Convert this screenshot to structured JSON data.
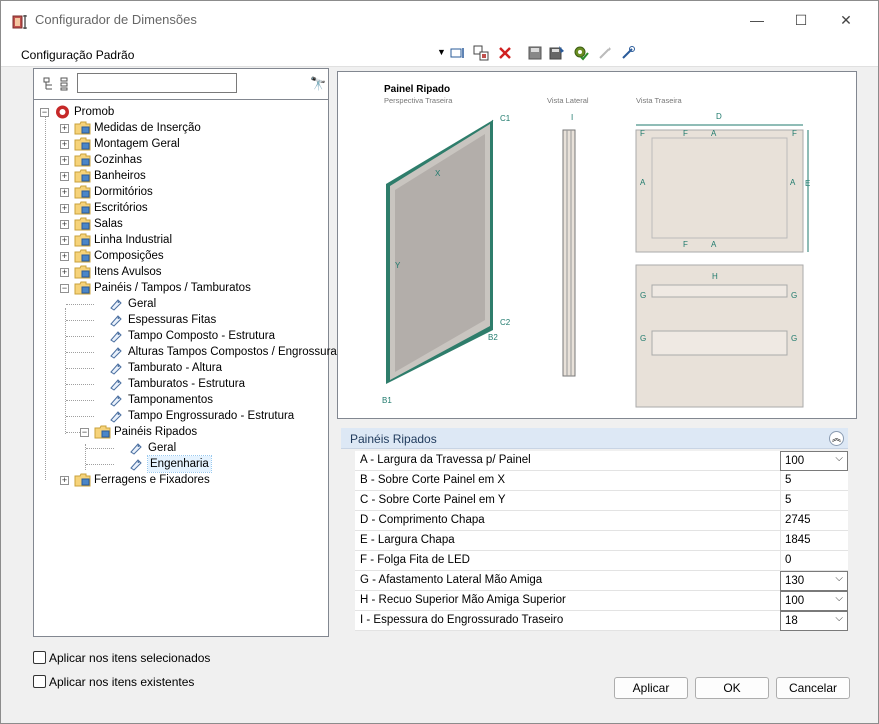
{
  "window": {
    "title": "Configurador de Dimensões",
    "min": "—",
    "max": "☐",
    "close": "✕"
  },
  "toolbar": {
    "config_name": "Configuração Padrão",
    "dropdown_arrow": "▼"
  },
  "left": {
    "search_value": "",
    "search_icon": "binoculars-icon"
  },
  "tree": {
    "root": "Promob",
    "items": [
      "Medidas de Inserção",
      "Montagem Geral",
      "Cozinhas",
      "Banheiros",
      "Dormitórios",
      "Escritórios",
      "Salas",
      "Linha Industrial",
      "Composições",
      "Itens Avulsos",
      "Painéis / Tampos / Tamburatos"
    ],
    "sub": [
      "Geral",
      "Espessuras Fitas",
      "Tampo Composto - Estrutura",
      "Alturas Tampos Compostos / Engrossurado",
      "Tamburato - Altura",
      "Tamburatos - Estrutura",
      "Tamponamentos",
      "Tampo Engrossurado - Estrutura",
      "Painéis Ripados"
    ],
    "subsub": [
      "Geral",
      "Engenharia"
    ],
    "last": "Ferragens e Fixadores"
  },
  "checks": {
    "selected": "Aplicar nos itens selecionados",
    "existing": "Aplicar nos itens existentes"
  },
  "preview": {
    "title": "Painel Ripado",
    "subtitle": "Perspectiva Traseira",
    "lateral": "Vista Lateral",
    "rear": "Vista Traseira",
    "labels": {
      "c1": "C1",
      "c2": "C2",
      "b1": "B1",
      "b2": "B2",
      "x": "X",
      "y": "Y",
      "i": "I",
      "d": "D",
      "e": "E",
      "f": "F",
      "a": "A",
      "g": "G",
      "h": "H"
    }
  },
  "props": {
    "header": "Painéis Ripados",
    "rows": [
      {
        "name": "A - Largura da Travessa p/ Painel",
        "value": "100",
        "dropdown": true
      },
      {
        "name": "B - Sobre Corte Painel em X",
        "value": "5",
        "dropdown": false
      },
      {
        "name": "C - Sobre Corte Painel em Y",
        "value": "5",
        "dropdown": false
      },
      {
        "name": "D - Comprimento Chapa",
        "value": "2745",
        "dropdown": false
      },
      {
        "name": "E - Largura Chapa",
        "value": "1845",
        "dropdown": false
      },
      {
        "name": "F - Folga Fita de LED",
        "value": "0",
        "dropdown": false
      },
      {
        "name": "G - Afastamento Lateral Mão Amiga",
        "value": "130",
        "dropdown": true
      },
      {
        "name": "H - Recuo Superior Mão Amiga Superior",
        "value": "100",
        "dropdown": true
      },
      {
        "name": "I - Espessura do Engrossurado Traseiro",
        "value": "18",
        "dropdown": true
      }
    ]
  },
  "buttons": {
    "apply": "Aplicar",
    "ok": "OK",
    "cancel": "Cancelar"
  },
  "colors": {
    "accent": "#1f7a6d",
    "panel_fill": "#e8e1d9",
    "header_bg": "#dde8f5"
  }
}
